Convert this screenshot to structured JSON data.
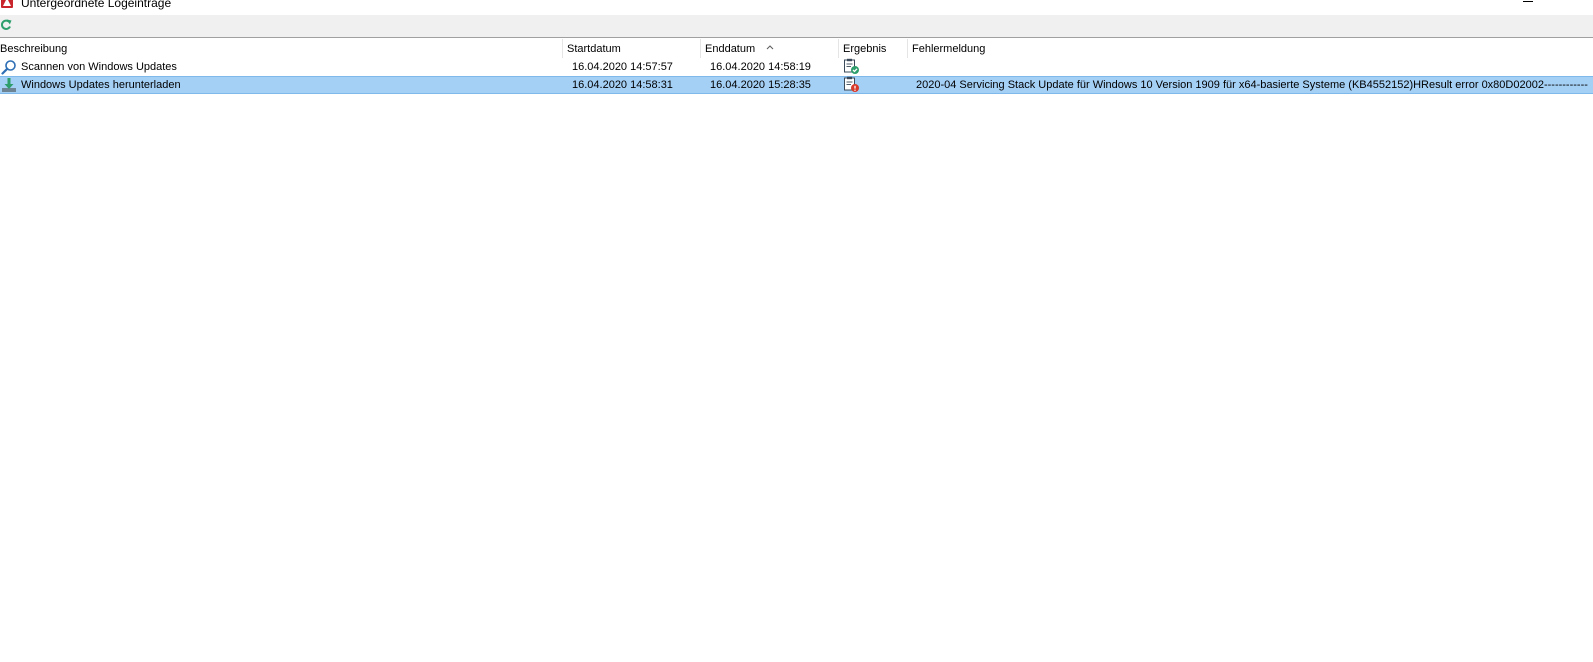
{
  "window": {
    "title": "Untergeordnete Logeinträge",
    "icons": [
      "app-icon",
      "minimize-icon"
    ]
  },
  "toolbar": {
    "refresh_icon": "refresh-icon",
    "accent": "#2e9e6c"
  },
  "table": {
    "columns": [
      {
        "label": "Beschreibung"
      },
      {
        "label": "Startdatum"
      },
      {
        "label": "Enddatum",
        "sorted": "ascending"
      },
      {
        "label": "Ergebnis"
      },
      {
        "label": "Fehlermeldung"
      }
    ],
    "rows": [
      {
        "icon": "search-icon",
        "description": "Scannen von Windows Updates",
        "start": "16.04.2020 14:57:57",
        "end": "16.04.2020 14:58:19",
        "result_icon": "success-log-icon",
        "error": "",
        "selected": false
      },
      {
        "icon": "download-icon",
        "description": "Windows Updates herunterladen",
        "start": "16.04.2020 14:58:31",
        "end": "16.04.2020 15:28:35",
        "result_icon": "error-log-icon",
        "error": "2020-04 Servicing Stack Update für Windows 10 Version 1909 für x64-basierte Systeme (KB4552152)HResult error 0x80D02002------------",
        "selected": true
      }
    ]
  },
  "colors": {
    "selection": "#a5d0f6",
    "selection_border": "#7fb9ec",
    "toolbar_bg": "#f0f0f0",
    "success": "#2e9e6c",
    "error": "#d83b2b"
  }
}
